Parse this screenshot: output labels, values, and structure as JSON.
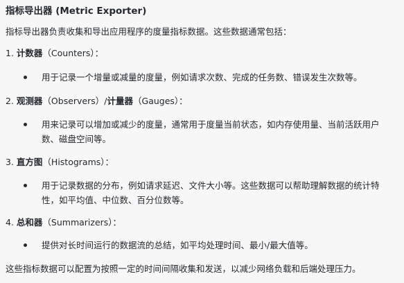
{
  "title": "指标导出器 (Metric Exporter)",
  "intro": "指标导出器负责收集和导出应用程序的度量指标数据。这些数据通常包括：",
  "sections": [
    {
      "prefix": "1. ",
      "bold": "计数器",
      "suffix": "（Counters）：",
      "bullet": "用于记录一个增量或减量的度量，例如请求次数、完成的任务数、错误发生次数等。"
    },
    {
      "prefix": "2. ",
      "bold": "观测器",
      "middle": "（Observers）/",
      "bold2": "计量器",
      "suffix": "（Gauges）：",
      "bullet": "用来记录可以增加或减少的度量，通常用于度量当前状态，如内存使用量、当前活跃用户数、磁盘空间等。"
    },
    {
      "prefix": "3. ",
      "bold": "直方图",
      "suffix": "（Histograms）：",
      "bullet": "用于记录数据的分布，例如请求延迟、文件大小等。这些数据可以帮助理解数据的统计特性，如平均值、中位数、百分位数等。"
    },
    {
      "prefix": "4. ",
      "bold": "总和器",
      "suffix": "（Summarizers）：",
      "bullet": "提供对长时间运行的数据流的总结，如平均处理时间、最小/最大值等。"
    }
  ],
  "outro": "这些指标数据可以配置为按照一定的时间间隔收集和发送，以减少网络负载和后端处理压力。"
}
